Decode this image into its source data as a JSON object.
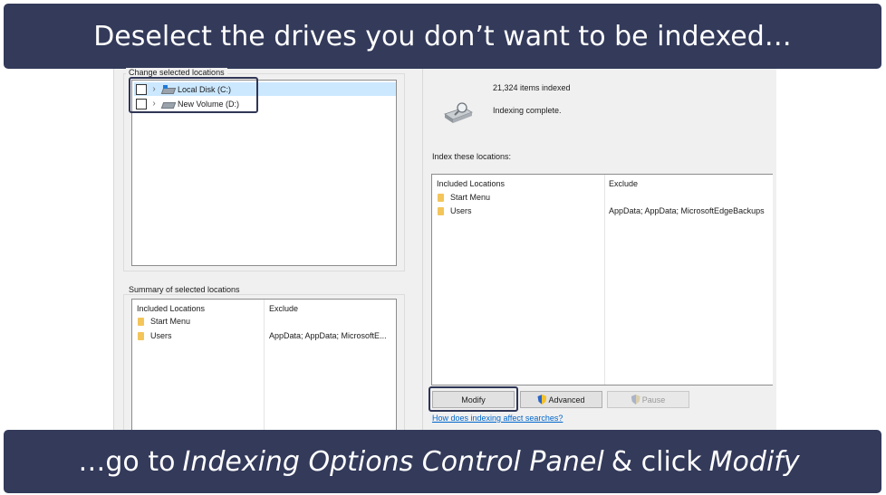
{
  "banners": {
    "top": "Deselect the drives you don’t want to be indexed…",
    "bottom_parts": [
      "…go to",
      "Indexing Options Control Panel",
      "& click",
      "Modify"
    ]
  },
  "indexed_locations_dialog": {
    "change_locations_label": "Change selected locations",
    "drives": [
      {
        "label": "Local Disk (C:)",
        "checked": false,
        "selected": true
      },
      {
        "label": "New Volume (D:)",
        "checked": false,
        "selected": false
      }
    ],
    "summary_label": "Summary of selected locations",
    "columns": [
      "Included Locations",
      "Exclude"
    ],
    "rows": [
      {
        "location": "Start Menu",
        "exclude": ""
      },
      {
        "location": "Users",
        "exclude": "AppData; AppData; MicrosoftE..."
      }
    ]
  },
  "indexing_options": {
    "items_indexed": "21,324 items indexed",
    "status": "Indexing complete.",
    "index_these_label": "Index these locations:",
    "columns": [
      "Included Locations",
      "Exclude"
    ],
    "rows": [
      {
        "location": "Start Menu",
        "exclude": ""
      },
      {
        "location": "Users",
        "exclude": "AppData; AppData; MicrosoftEdgeBackups"
      }
    ],
    "buttons": {
      "modify": "Modify",
      "advanced": "Advanced",
      "pause": "Pause"
    },
    "help_link": "How does indexing affect searches?"
  },
  "colors": {
    "banner": "#333a5a",
    "highlight_border": "#2f3656",
    "selection": "#cce8ff",
    "link": "#0066cc"
  },
  "icons": [
    "chevron-right-icon",
    "drive-icon",
    "folder-icon",
    "uac-shield-icon",
    "hard-drive-search-icon"
  ]
}
